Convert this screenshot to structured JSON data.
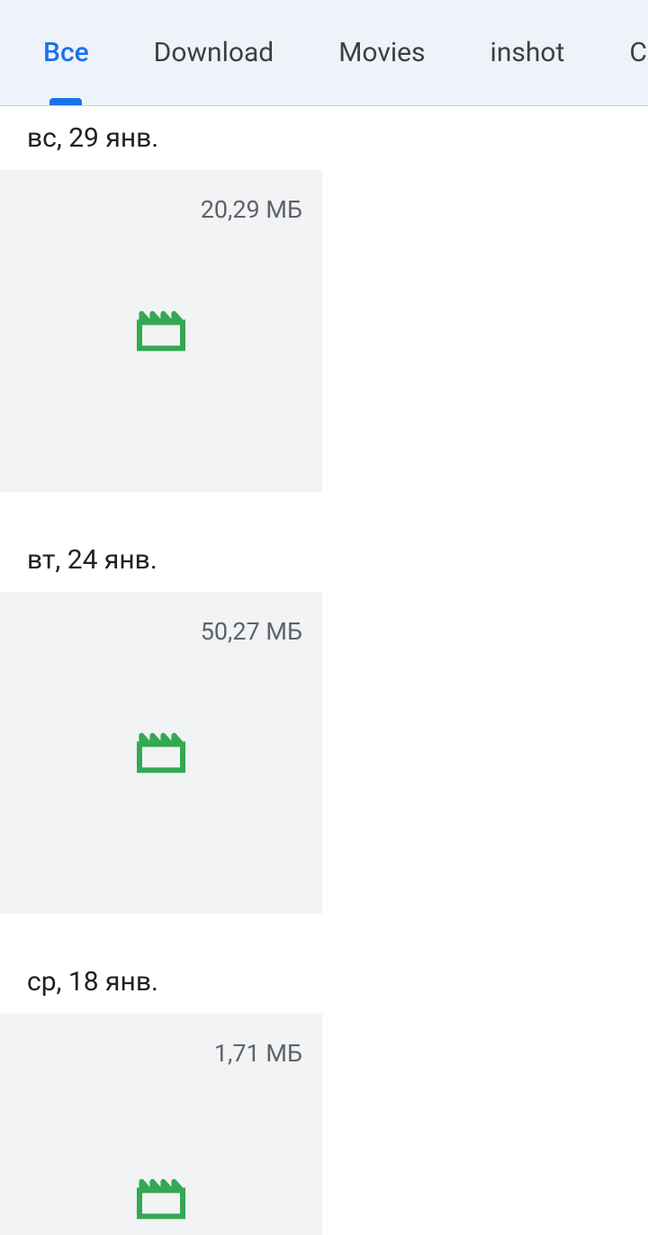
{
  "tabs": [
    {
      "label": "Все",
      "active": true
    },
    {
      "label": "Download",
      "active": false
    },
    {
      "label": "Movies",
      "active": false
    },
    {
      "label": "inshot",
      "active": false
    },
    {
      "label": "Camera",
      "active": false
    }
  ],
  "groups": [
    {
      "date": "вс, 29 янв.",
      "size": "20,29 МБ"
    },
    {
      "date": "вт, 24 янв.",
      "size": "50,27 МБ"
    },
    {
      "date": "ср, 18 янв.",
      "size": "1,71 МБ"
    }
  ]
}
